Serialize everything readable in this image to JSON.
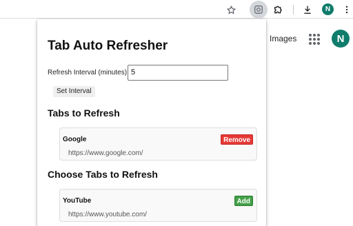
{
  "browser": {
    "avatar_initial": "N",
    "icons": [
      "star-icon",
      "extension-icon",
      "puzzle-icon",
      "download-icon",
      "kebab-menu-icon"
    ]
  },
  "google": {
    "images_link": "Images",
    "avatar_initial": "N",
    "avatar_color": "#0f7c6c"
  },
  "popup": {
    "title": "Tab Auto Refresher",
    "interval_label": "Refresh Interval (minutes):",
    "interval_value": "5",
    "set_button": "Set Interval",
    "tabs_heading": "Tabs to Refresh",
    "choose_heading": "Choose Tabs to Refresh",
    "refresh_tabs": [
      {
        "name": "Google",
        "url": "https://www.google.com/",
        "action": "Remove"
      }
    ],
    "available_tabs": [
      {
        "name": "YouTube",
        "url": "https://www.youtube.com/",
        "action": "Add"
      }
    ]
  },
  "colors": {
    "remove": "#e53935",
    "add": "#43a047"
  }
}
